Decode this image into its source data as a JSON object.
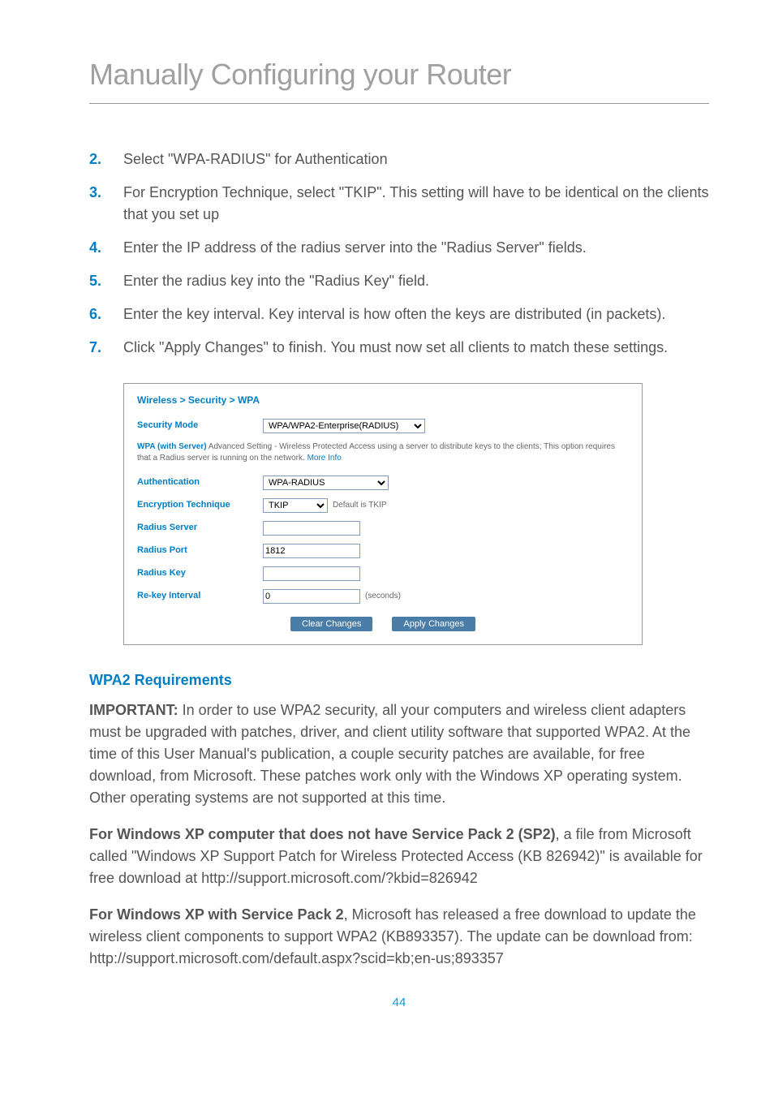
{
  "page_title": "Manually Configuring your Router",
  "steps": [
    {
      "num": "2.",
      "text": "Select \"WPA-RADIUS\" for Authentication"
    },
    {
      "num": "3.",
      "text": "For Encryption Technique, select \"TKIP\". This setting will have to be identical on the clients that you set up"
    },
    {
      "num": "4.",
      "text": "Enter the IP address of the radius server into the \"Radius Server\" fields."
    },
    {
      "num": "5.",
      "text": "Enter the radius key into the \"Radius Key\" field."
    },
    {
      "num": "6.",
      "text": "Enter the key interval. Key interval is how often the keys are distributed (in packets)."
    },
    {
      "num": "7.",
      "text": "Click \"Apply Changes\" to finish. You must now set all clients to match these settings."
    }
  ],
  "screenshot": {
    "breadcrumb": "Wireless > Security > WPA",
    "security_mode_label": "Security Mode",
    "security_mode_value": "WPA/WPA2-Enterprise(RADIUS)",
    "note_bold": "WPA (with Server)",
    "note_rest": " Advanced Setting - Wireless Protected Access using a server to distribute keys to the clients; This option requires that a Radius server is running on the network. ",
    "note_more": "More Info",
    "auth_label": "Authentication",
    "auth_value": "WPA-RADIUS",
    "enc_label": "Encryption Technique",
    "enc_value": "TKIP",
    "enc_default": "Default is TKIP",
    "radius_server_label": "Radius Server",
    "radius_server_value": "",
    "radius_port_label": "Radius Port",
    "radius_port_value": "1812",
    "radius_key_label": "Radius Key",
    "radius_key_value": "",
    "rekey_label": "Re-key Interval",
    "rekey_value": "0",
    "rekey_unit": "(seconds)",
    "btn_clear": "Clear Changes",
    "btn_apply": "Apply Changes"
  },
  "section_heading": "WPA2 Requirements",
  "important_label": "IMPORTANT:",
  "important_text": " In order to use WPA2 security, all your computers and wireless client adapters must be upgraded with patches, driver, and client utility software that supported WPA2. At the time of this User Manual's publication, a couple security patches are available, for free download, from Microsoft. These patches work only with the Windows XP operating system. Other operating systems are not supported at this time.",
  "para2_bold": "For Windows XP computer that does not have Service Pack 2 (SP2)",
  "para2_rest": ", a file from Microsoft called \"Windows XP Support Patch for Wireless Protected Access (KB 826942)\" is available for free download at http://support.microsoft.com/?kbid=826942",
  "para3_bold": "For Windows XP with Service Pack 2",
  "para3_rest": ", Microsoft has released a free download to update the wireless client components to support WPA2 (KB893357). The update can be download from:  http://support.microsoft.com/default.aspx?scid=kb;en-us;893357",
  "page_number": "44"
}
